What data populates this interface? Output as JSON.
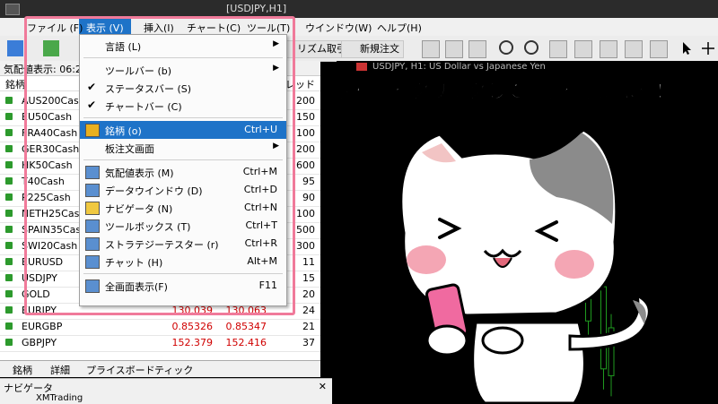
{
  "window": {
    "title": "[USDJPY,H1]"
  },
  "menubar": {
    "items": [
      "ファイル (F)",
      "表示 (V)",
      "挿入(I)",
      "チャート(C)",
      "ツール(T)",
      "ウインドウ(W)",
      "ヘルプ(H)"
    ]
  },
  "toolbar": {
    "algo_label": "リズム取引",
    "new_order_label": "新規注文"
  },
  "market_watch": {
    "title": "気配値表示: 06:2",
    "col_symbol": "銘柄",
    "col_spread": "プレッド",
    "rows": [
      {
        "symbol": "AUS200Cash",
        "bid": "",
        "ask": "",
        "digits": "200"
      },
      {
        "symbol": "EU50Cash",
        "bid": "",
        "ask": "",
        "digits": "150"
      },
      {
        "symbol": "FRA40Cash",
        "bid": "",
        "ask": "",
        "digits": "100"
      },
      {
        "symbol": "GER30Cash",
        "bid": "",
        "ask": "",
        "digits": "200"
      },
      {
        "symbol": "HK50Cash",
        "bid": "",
        "ask": "",
        "digits": "600"
      },
      {
        "symbol": "T40Cash",
        "bid": "",
        "ask": "",
        "digits": "95"
      },
      {
        "symbol": "P225Cash",
        "bid": "",
        "ask": "",
        "digits": "90"
      },
      {
        "symbol": "NETH25Cash",
        "bid": "",
        "ask": "",
        "digits": "100"
      },
      {
        "symbol": "SPAIN35Cash",
        "bid": "",
        "ask": "",
        "digits": "500"
      },
      {
        "symbol": "SWI20Cash",
        "bid": "",
        "ask": "",
        "digits": "300"
      },
      {
        "symbol": "EURUSD",
        "bid": "",
        "ask": "",
        "digits": "11"
      },
      {
        "symbol": "USDJPY",
        "bid": "",
        "ask": "",
        "digits": "15"
      },
      {
        "symbol": "GOLD",
        "bid": "",
        "ask": "",
        "digits": "20"
      },
      {
        "symbol": "EURJPY",
        "bid": "130.039",
        "ask": "130.063",
        "digits": "24"
      },
      {
        "symbol": "EURGBP",
        "bid": "0.85326",
        "ask": "0.85347",
        "digits": "21"
      },
      {
        "symbol": "GBPJPY",
        "bid": "152.379",
        "ask": "152.416",
        "digits": "37"
      }
    ],
    "tabs": [
      "銘柄",
      "詳細",
      "プライスボード",
      "ティック"
    ]
  },
  "navigator": {
    "title": "ナビゲータ",
    "item": "XMTrading"
  },
  "chart": {
    "header": "USDJPY, H1:  US Dollar vs Japanese Yen",
    "candles": [
      {
        "x": 0.4,
        "o": 0.52,
        "c": 0.63,
        "h": 0.49,
        "l": 0.66
      },
      {
        "x": 0.56,
        "o": 0.55,
        "c": 0.7,
        "h": 0.53,
        "l": 0.74
      },
      {
        "x": 0.66,
        "o": 0.58,
        "c": 0.76,
        "h": 0.55,
        "l": 0.8
      },
      {
        "x": 0.7,
        "o": 0.66,
        "c": 0.9,
        "h": 0.62,
        "l": 0.96
      },
      {
        "x": 0.72,
        "o": 0.78,
        "c": 0.92,
        "h": 0.74,
        "l": 0.98
      }
    ]
  },
  "view_menu": {
    "items": [
      {
        "label": "言語 (L)",
        "shortcut": "",
        "submenu": true,
        "check": false,
        "icon": ""
      },
      {
        "label": "ツールバー (b)",
        "shortcut": "",
        "submenu": true,
        "check": false,
        "icon": ""
      },
      {
        "label": "ステータスバー (S)",
        "shortcut": "",
        "submenu": false,
        "check": true,
        "icon": ""
      },
      {
        "label": "チャートバー (C)",
        "shortcut": "",
        "submenu": false,
        "check": true,
        "icon": ""
      },
      {
        "label": "銘柄 (o)",
        "shortcut": "Ctrl+U",
        "submenu": false,
        "check": false,
        "icon": "symbols-icon",
        "highlighted": true
      },
      {
        "label": "板注文画面",
        "shortcut": "",
        "submenu": true,
        "check": false,
        "icon": ""
      },
      {
        "label": "気配値表示 (M)",
        "shortcut": "Ctrl+M",
        "submenu": false,
        "check": false,
        "icon": "market-watch-icon"
      },
      {
        "label": "データウインドウ (D)",
        "shortcut": "Ctrl+D",
        "submenu": false,
        "check": false,
        "icon": "data-window-icon"
      },
      {
        "label": "ナビゲータ (N)",
        "shortcut": "Ctrl+N",
        "submenu": false,
        "check": false,
        "icon": "navigator-icon"
      },
      {
        "label": "ツールボックス (T)",
        "shortcut": "Ctrl+T",
        "submenu": false,
        "check": false,
        "icon": "toolbox-icon"
      },
      {
        "label": "ストラテジーテスター (r)",
        "shortcut": "Ctrl+R",
        "submenu": false,
        "check": false,
        "icon": "strategy-tester-icon"
      },
      {
        "label": "チャット (H)",
        "shortcut": "Alt+M",
        "submenu": false,
        "check": false,
        "icon": "chat-icon"
      },
      {
        "label": "全画面表示(F)",
        "shortcut": "F11",
        "submenu": false,
        "check": false,
        "icon": "fullscreen-icon"
      }
    ]
  },
  "banner": {
    "text": "「銘柄」をクリックして設定を進めよう！"
  },
  "colors": {
    "highlight": "#1e73c8",
    "frame": "#f07a9a",
    "bear": "#d00000",
    "candle": "#1f9a1f"
  }
}
